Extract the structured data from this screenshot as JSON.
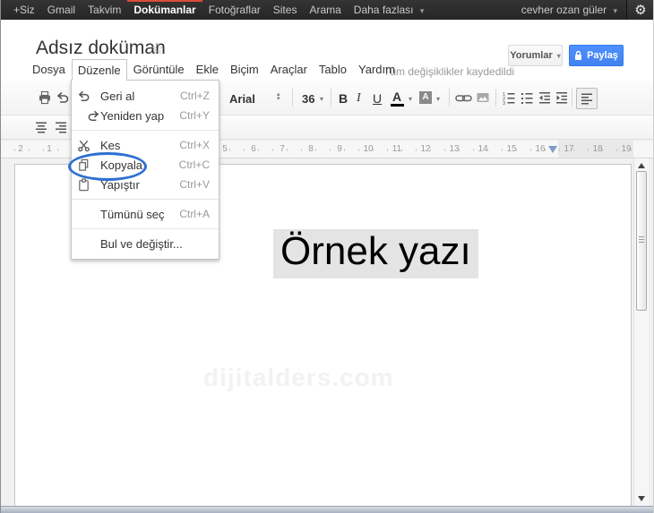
{
  "topbar": {
    "nav": [
      {
        "label": "+Siz"
      },
      {
        "label": "Gmail"
      },
      {
        "label": "Takvim"
      },
      {
        "label": "Dokümanlar",
        "active": true
      },
      {
        "label": "Fotoğraflar"
      },
      {
        "label": "Sites"
      },
      {
        "label": "Arama"
      },
      {
        "label": "Daha fazlası",
        "has_dropdown": true
      }
    ],
    "account_label": "cevher ozan güler"
  },
  "header": {
    "title": "Adsız doküman",
    "comments_label": "Yorumlar",
    "share_label": "Paylaş"
  },
  "menubar": {
    "items": [
      "Dosya",
      "Düzenle",
      "Görüntüle",
      "Ekle",
      "Biçim",
      "Araçlar",
      "Tablo",
      "Yardım"
    ],
    "open_item": "Düzenle",
    "saved_status": "Tüm değişiklikler kaydedildi"
  },
  "edit_menu": {
    "items": [
      {
        "label": "Geri al",
        "shortcut": "Ctrl+Z",
        "icon": "undo"
      },
      {
        "label": "Yeniden yap",
        "shortcut": "Ctrl+Y",
        "icon": "redo"
      },
      {
        "label": "Kes",
        "shortcut": "Ctrl+X",
        "icon": "scissors"
      },
      {
        "label": "Kopyala",
        "shortcut": "Ctrl+C",
        "icon": "copy",
        "annotated": true
      },
      {
        "label": "Yapıştır",
        "shortcut": "Ctrl+V",
        "icon": "clipboard"
      },
      {
        "label": "Tümünü seç",
        "shortcut": "Ctrl+A",
        "icon": ""
      },
      {
        "label": "Bul ve değiştir...",
        "shortcut": "",
        "icon": ""
      }
    ]
  },
  "toolbar": {
    "font_family_value": "Arial",
    "font_size_value": "36",
    "bold_label": "B",
    "italic_label": "I",
    "underline_label": "U",
    "text_color_label": "A",
    "highlight_label": "A"
  },
  "ruler": {
    "margin_numbers": [
      "2",
      "1"
    ],
    "numbers": [
      "5",
      "6",
      "7",
      "8",
      "9",
      "10",
      "11",
      "12",
      "13",
      "14",
      "15",
      "16",
      "17",
      "18",
      "19"
    ]
  },
  "document": {
    "text": "Örnek yazı",
    "watermark": "dijitalders.com"
  },
  "icons": {
    "caret_down": "▾",
    "caret_up": "▴",
    "gear": "⚙",
    "star": "☆"
  },
  "colors": {
    "topbar_bg": "#2b2b2b",
    "brand_red": "#dd4b39",
    "share_button_blue": "#4d90fe",
    "annotation_blue": "#2e70d2",
    "selection_gray": "#e4e4e4"
  }
}
